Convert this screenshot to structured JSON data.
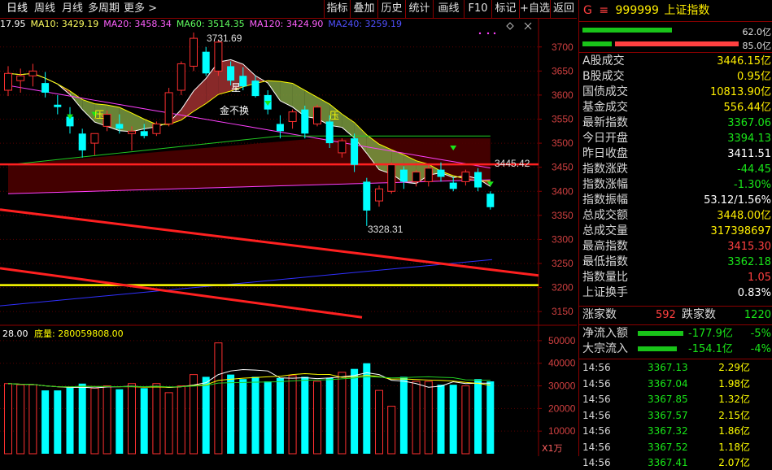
{
  "toolbar": {
    "left_tabs": [
      "日线",
      "周线",
      "月线",
      "多周期",
      "更多 >"
    ],
    "right_buttons": [
      "指标",
      "叠加",
      "历史",
      "统计",
      "画线",
      "F10",
      "标记",
      "+自选",
      "返回"
    ]
  },
  "ma_legend": {
    "lead": "17.95",
    "ma10": "MA10: 3429.19",
    "ma20": "MA20: 3458.34",
    "ma60": "MA60: 3514.35",
    "ma120": "MA120: 3424.90",
    "ma240": "MA240: 3259.19"
  },
  "chart_annotations": {
    "high": "3731.69",
    "low": "3328.31",
    "last_level": "3445.42",
    "ya_1": "压",
    "ya_2": "压",
    "gold_cross": "金不换",
    "star": "星",
    "zoom": "X1万"
  },
  "colors": {
    "up": "#ff3030",
    "down": "#00ffff",
    "ma10": "#ffffff",
    "ma20": "#ffff00",
    "ma60": "#ff00ff",
    "ma120": "#00c000",
    "ma240": "#3030ff",
    "grid_red": "#8b0000",
    "panel_bg": "#000000"
  },
  "price_axis": [
    "3700",
    "3650",
    "3600",
    "3550",
    "3500",
    "3450",
    "3400",
    "3350",
    "3300",
    "3250",
    "3200",
    "3150"
  ],
  "volume_axis": [
    "50000",
    "40000",
    "30000",
    "20000",
    "10000"
  ],
  "volume_legend": {
    "lead": "28.00",
    "label": "底量: 280059808.00"
  },
  "chart_data": {
    "type": "candlestick",
    "ylim": [
      3130,
      3730
    ],
    "candles": [
      {
        "o": 3610,
        "h": 3660,
        "l": 3598,
        "c": 3645
      },
      {
        "o": 3630,
        "h": 3655,
        "l": 3605,
        "c": 3640
      },
      {
        "o": 3640,
        "h": 3665,
        "l": 3618,
        "c": 3650
      },
      {
        "o": 3625,
        "h": 3648,
        "l": 3595,
        "c": 3605
      },
      {
        "o": 3580,
        "h": 3600,
        "l": 3560,
        "c": 3575
      },
      {
        "o": 3555,
        "h": 3575,
        "l": 3520,
        "c": 3535
      },
      {
        "o": 3520,
        "h": 3530,
        "l": 3470,
        "c": 3485
      },
      {
        "o": 3500,
        "h": 3520,
        "l": 3475,
        "c": 3520
      },
      {
        "o": 3535,
        "h": 3568,
        "l": 3525,
        "c": 3560
      },
      {
        "o": 3540,
        "h": 3560,
        "l": 3520,
        "c": 3530
      },
      {
        "o": 3520,
        "h": 3535,
        "l": 3485,
        "c": 3525
      },
      {
        "o": 3525,
        "h": 3540,
        "l": 3510,
        "c": 3515
      },
      {
        "o": 3520,
        "h": 3545,
        "l": 3515,
        "c": 3540
      },
      {
        "o": 3540,
        "h": 3615,
        "l": 3535,
        "c": 3605
      },
      {
        "o": 3610,
        "h": 3670,
        "l": 3600,
        "c": 3665
      },
      {
        "o": 3660,
        "h": 3730,
        "l": 3650,
        "c": 3718
      },
      {
        "o": 3690,
        "h": 3700,
        "l": 3640,
        "c": 3645
      },
      {
        "o": 3650,
        "h": 3715,
        "l": 3640,
        "c": 3710
      },
      {
        "o": 3660,
        "h": 3670,
        "l": 3620,
        "c": 3630
      },
      {
        "o": 3640,
        "h": 3658,
        "l": 3610,
        "c": 3618
      },
      {
        "o": 3630,
        "h": 3640,
        "l": 3595,
        "c": 3598
      },
      {
        "o": 3600,
        "h": 3610,
        "l": 3560,
        "c": 3570
      },
      {
        "o": 3540,
        "h": 3558,
        "l": 3510,
        "c": 3525
      },
      {
        "o": 3545,
        "h": 3570,
        "l": 3530,
        "c": 3565
      },
      {
        "o": 3570,
        "h": 3578,
        "l": 3510,
        "c": 3520
      },
      {
        "o": 3540,
        "h": 3580,
        "l": 3535,
        "c": 3575
      },
      {
        "o": 3545,
        "h": 3558,
        "l": 3490,
        "c": 3500
      },
      {
        "o": 3480,
        "h": 3510,
        "l": 3470,
        "c": 3505
      },
      {
        "o": 3510,
        "h": 3520,
        "l": 3440,
        "c": 3455
      },
      {
        "o": 3420,
        "h": 3428,
        "l": 3328,
        "c": 3360
      },
      {
        "o": 3380,
        "h": 3412,
        "l": 3368,
        "c": 3405
      },
      {
        "o": 3400,
        "h": 3460,
        "l": 3395,
        "c": 3455
      },
      {
        "o": 3445,
        "h": 3452,
        "l": 3405,
        "c": 3420
      },
      {
        "o": 3420,
        "h": 3445,
        "l": 3410,
        "c": 3440
      },
      {
        "o": 3420,
        "h": 3455,
        "l": 3410,
        "c": 3448
      },
      {
        "o": 3445,
        "h": 3460,
        "l": 3420,
        "c": 3430
      },
      {
        "o": 3418,
        "h": 3430,
        "l": 3400,
        "c": 3405
      },
      {
        "o": 3420,
        "h": 3445,
        "l": 3412,
        "c": 3440
      },
      {
        "o": 3440,
        "h": 3448,
        "l": 3400,
        "c": 3408
      },
      {
        "o": 3395,
        "h": 3400,
        "l": 3362,
        "c": 3367
      }
    ],
    "volumes": [
      31000,
      30500,
      30500,
      28000,
      28000,
      29500,
      31000,
      29000,
      30000,
      28500,
      31000,
      29000,
      31000,
      27000,
      30000,
      35000,
      34000,
      49000,
      35000,
      33000,
      34000,
      32000,
      33500,
      34500,
      34000,
      32000,
      33500,
      36000,
      37500,
      40000,
      28000,
      21000,
      34000,
      32000,
      32000,
      30500,
      30500,
      30000,
      33000,
      32000
    ],
    "volume_ylim": [
      0,
      55000
    ]
  },
  "right_panel": {
    "header": {
      "g": "G",
      "code": "999999",
      "name": "上证指数"
    },
    "bars": [
      {
        "value": "62.0亿"
      },
      {
        "value": "85.0亿"
      }
    ],
    "rows": [
      {
        "k": "A股成交",
        "v": "3446.15亿",
        "c": "yellow"
      },
      {
        "k": "B股成交",
        "v": "0.95亿",
        "c": "yellow"
      },
      {
        "k": "国债成交",
        "v": "10813.90亿",
        "c": "yellow"
      },
      {
        "k": "基金成交",
        "v": "556.44亿",
        "c": "yellow"
      },
      {
        "k": "最新指数",
        "v": "3367.06",
        "c": "green"
      },
      {
        "k": "今日开盘",
        "v": "3394.13",
        "c": "green"
      },
      {
        "k": "昨日收盘",
        "v": "3411.51",
        "c": "white"
      },
      {
        "k": "指数涨跌",
        "v": "-44.45",
        "c": "green"
      },
      {
        "k": "指数涨幅",
        "v": "-1.30%",
        "c": "green"
      },
      {
        "k": "指数振幅",
        "v": "53.12/1.56%",
        "c": "white"
      },
      {
        "k": "总成交额",
        "v": "3448.00亿",
        "c": "yellow"
      },
      {
        "k": "总成交量",
        "v": "317398697",
        "c": "yellow"
      },
      {
        "k": "最高指数",
        "v": "3415.30",
        "c": "red"
      },
      {
        "k": "最低指数",
        "v": "3362.18",
        "c": "green"
      },
      {
        "k": "指数量比",
        "v": "1.05",
        "c": "red"
      },
      {
        "k": "上证换手",
        "v": "0.83%",
        "c": "white"
      }
    ],
    "updown": {
      "up_label": "涨家数",
      "up": "592",
      "down_label": "跌家数",
      "down": "1220"
    },
    "flows": [
      {
        "k": "净流入额",
        "v": "-177.9亿",
        "p": "-5%"
      },
      {
        "k": "大宗流入",
        "v": "-154.1亿",
        "p": "-4%"
      }
    ],
    "ticks": [
      {
        "t": "14:56",
        "p": "3367.13",
        "q": "2.29亿"
      },
      {
        "t": "14:56",
        "p": "3367.04",
        "q": "1.98亿"
      },
      {
        "t": "14:56",
        "p": "3367.85",
        "q": "1.32亿"
      },
      {
        "t": "14:56",
        "p": "3367.57",
        "q": "2.15亿"
      },
      {
        "t": "14:56",
        "p": "3367.32",
        "q": "1.86亿"
      },
      {
        "t": "14:56",
        "p": "3367.52",
        "q": "1.18亿"
      },
      {
        "t": "14:56",
        "p": "3367.41",
        "q": "2.07亿"
      }
    ]
  }
}
